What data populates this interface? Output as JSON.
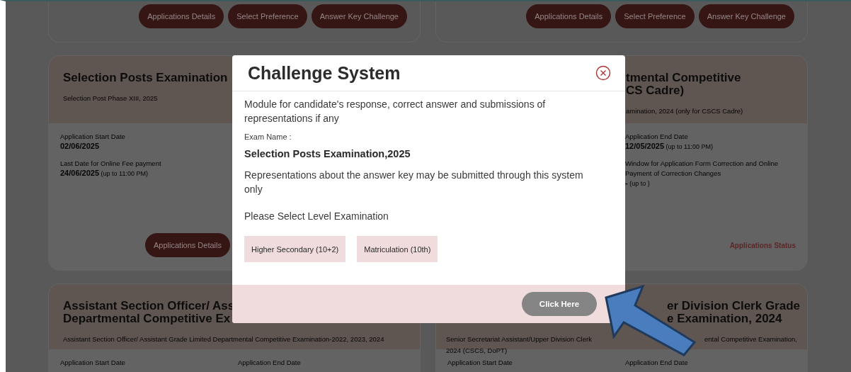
{
  "page": {
    "top_cards": [
      {
        "buttons": [
          "Applications Details",
          "Select Preference",
          "Answer Key Challenge"
        ]
      },
      {
        "buttons": [
          "Applications Details",
          "Select Preference",
          "Answer Key Challenge"
        ]
      }
    ],
    "cards": [
      {
        "title_lines": [
          "Selection Posts Examination"
        ],
        "subtitle_parts": [
          "Selection Post Phase XIII, 2025"
        ],
        "fields": [
          {
            "label": "Application Start Date",
            "value": "02/06/2025"
          },
          {
            "label": "Last Date for Online Fee payment",
            "value": "24/06/2025",
            "note": "(up to 11:00 PM)"
          }
        ],
        "action": {
          "kind": "button",
          "label": "Applications Details"
        }
      },
      {
        "title_lines": [
          "tmental Competitive",
          "CS Cadre)"
        ],
        "subtitle_parts": [
          "amination, 2024 (only for CSCS Cadre)"
        ],
        "fields": [
          {
            "label": "Application End Date",
            "value": "12/05/2025",
            "note": "(up to 11:00 PM)"
          },
          {
            "label": "Window for Application Form Correction and Online Payment of Correction Changes",
            "value": "-",
            "note": "(up to )"
          }
        ],
        "action": {
          "kind": "link",
          "label": "Applications Status"
        }
      },
      {
        "title_lines": [
          "Assistant Section Officer/ Ass",
          "Departmental Competitive Ex"
        ],
        "subtitle_parts": [
          "Assistant Section Officer/ Assistant Grade Limited Departmental Competitive Examination-2022, 2023, 2024"
        ],
        "fields": [
          {
            "label": "Application Start Date"
          },
          {
            "label": "Application End Date"
          }
        ]
      },
      {
        "title_lines": [
          "er Division Clerk Grade",
          "e Examination, 2024"
        ],
        "subtitle_parts": [
          "Senior Secretariat Assistant/Upper Division Clerk",
          "ental Competitive Examination,",
          "2024 (CSCS, DoPT)"
        ],
        "fields": [
          {
            "label": "Application Start Date"
          },
          {
            "label": "Application End Date"
          }
        ]
      }
    ]
  },
  "modal": {
    "title": "Challenge System",
    "intro": "Module for candidate's response, correct answer and submissions of representations if any",
    "exam_label": "Exam Name :",
    "exam_name": "Selection Posts Examination,2025",
    "note": "Representations about the answer key may be submitted through this system only",
    "prompt": "Please Select Level Examination",
    "options": [
      "Higher Secondary (10+2)",
      "Matriculation (10th)"
    ],
    "footer_button": "Click Here"
  }
}
